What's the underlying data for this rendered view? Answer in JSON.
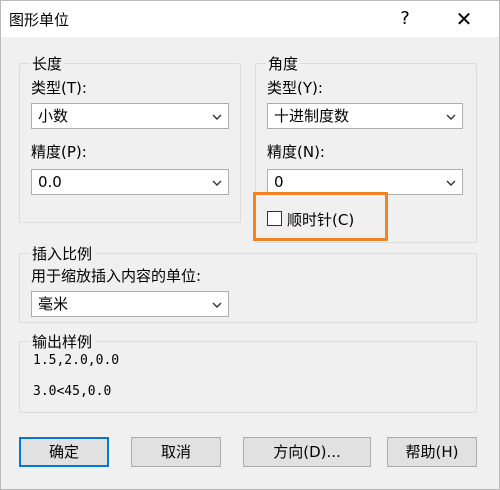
{
  "window": {
    "title": "图形单位",
    "help_label": "?",
    "close_label": "✕"
  },
  "length": {
    "group_title": "长度",
    "type_label": "类型(T):",
    "type_value": "小数",
    "precision_label": "精度(P):",
    "precision_value": "0.0"
  },
  "angle": {
    "group_title": "角度",
    "type_label": "类型(Y):",
    "type_value": "十进制度数",
    "precision_label": "精度(N):",
    "precision_value": "0",
    "clockwise_label": "顺时针(C)",
    "clockwise_checked": false
  },
  "insertion": {
    "group_title": "插入比例",
    "units_label": "用于缩放插入内容的单位:",
    "units_value": "毫米"
  },
  "sample": {
    "group_title": "输出样例",
    "line1": "1.5,2.0,0.0",
    "line2": "3.0<45,0.0"
  },
  "buttons": {
    "ok": "确定",
    "cancel": "取消",
    "direction": "方向(D)...",
    "help": "帮助(H)"
  },
  "colors": {
    "highlight": "#f58220",
    "default_button_border": "#0078d7"
  }
}
